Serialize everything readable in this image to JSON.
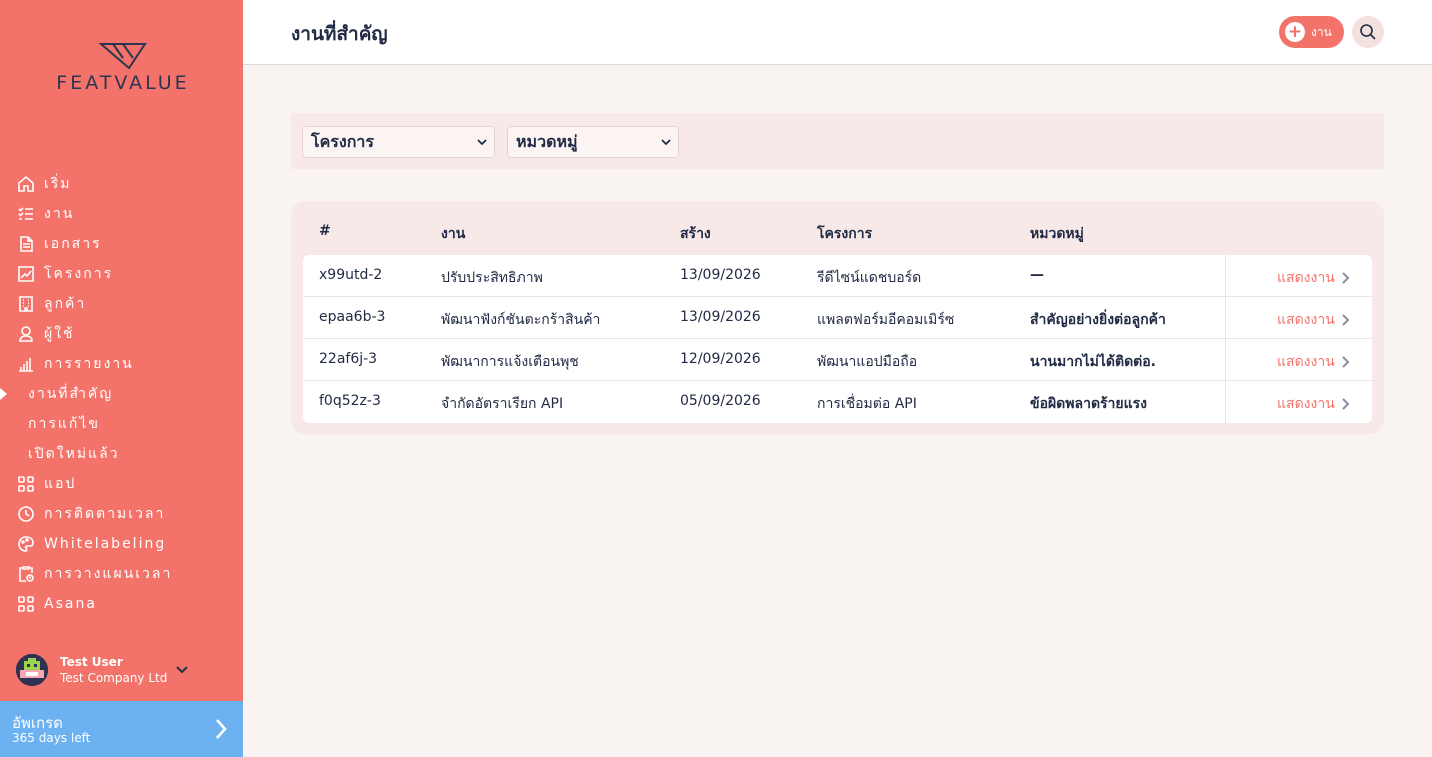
{
  "brand": {
    "name": "FEATVALUE"
  },
  "header": {
    "title": "งานที่สำคัญ",
    "add_label": "งาน"
  },
  "sidebar": {
    "items": [
      {
        "label": "เริ่ม",
        "icon": "home-icon"
      },
      {
        "label": "งาน",
        "icon": "checklist-icon"
      },
      {
        "label": "เอกสาร",
        "icon": "document-icon"
      },
      {
        "label": "โครงการ",
        "icon": "chart-icon"
      },
      {
        "label": "ลูกค้า",
        "icon": "building-icon"
      },
      {
        "label": "ผู้ใช้",
        "icon": "user-icon"
      },
      {
        "label": "การรายงาน",
        "icon": "bar-chart-icon"
      },
      {
        "label": "งานที่สำคัญ",
        "icon": ""
      },
      {
        "label": "การแก้ไข",
        "icon": ""
      },
      {
        "label": "เปิดใหม่แล้ว",
        "icon": ""
      },
      {
        "label": "แอป",
        "icon": "apps-icon"
      },
      {
        "label": "การติดตามเวลา",
        "icon": "timer-icon"
      },
      {
        "label": "Whitelabeling",
        "icon": "palette-icon"
      },
      {
        "label": "การวางแผนเวลา",
        "icon": "clipboard-clock-icon"
      },
      {
        "label": "Asana",
        "icon": "apps-icon"
      }
    ]
  },
  "user": {
    "name": "Test User",
    "company": "Test Company Ltd"
  },
  "upgrade": {
    "title": "อัพเกรด",
    "days_left": "365 days left"
  },
  "filters": {
    "project": "โครงการ",
    "category": "หมวดหมู่"
  },
  "table": {
    "headers": [
      "#",
      "งาน",
      "สร้าง",
      "โครงการ",
      "หมวดหมู่"
    ],
    "rows": [
      {
        "id": "x99utd-2",
        "task": "ปรับประสิทธิภาพ",
        "created": "13/09/2026",
        "project": "รีดีไซน์แดชบอร์ด",
        "category": "—",
        "action": "แสดงงาน"
      },
      {
        "id": "epaa6b-3",
        "task": "พัฒนาฟังก์ชันตะกร้าสินค้า",
        "created": "13/09/2026",
        "project": "แพลตฟอร์มอีคอมเมิร์ซ",
        "category": "สำคัญอย่างยิ่งต่อลูกค้า",
        "action": "แสดงงาน"
      },
      {
        "id": "22af6j-3",
        "task": "พัฒนาการแจ้งเตือนพุช",
        "created": "12/09/2026",
        "project": "พัฒนาแอปมือถือ",
        "category": "นานมากไม่ได้ติดต่อ.",
        "action": "แสดงงาน"
      },
      {
        "id": "f0q52z-3",
        "task": "จำกัดอัตราเรียก API",
        "created": "05/09/2026",
        "project": "การเชื่อมต่อ API",
        "category": "ข้อผิดพลาดร้ายแรง",
        "action": "แสดงงาน"
      }
    ]
  },
  "colors": {
    "accent": "#f3736b",
    "upgrade": "#6cb2f1",
    "text": "#222b45"
  }
}
